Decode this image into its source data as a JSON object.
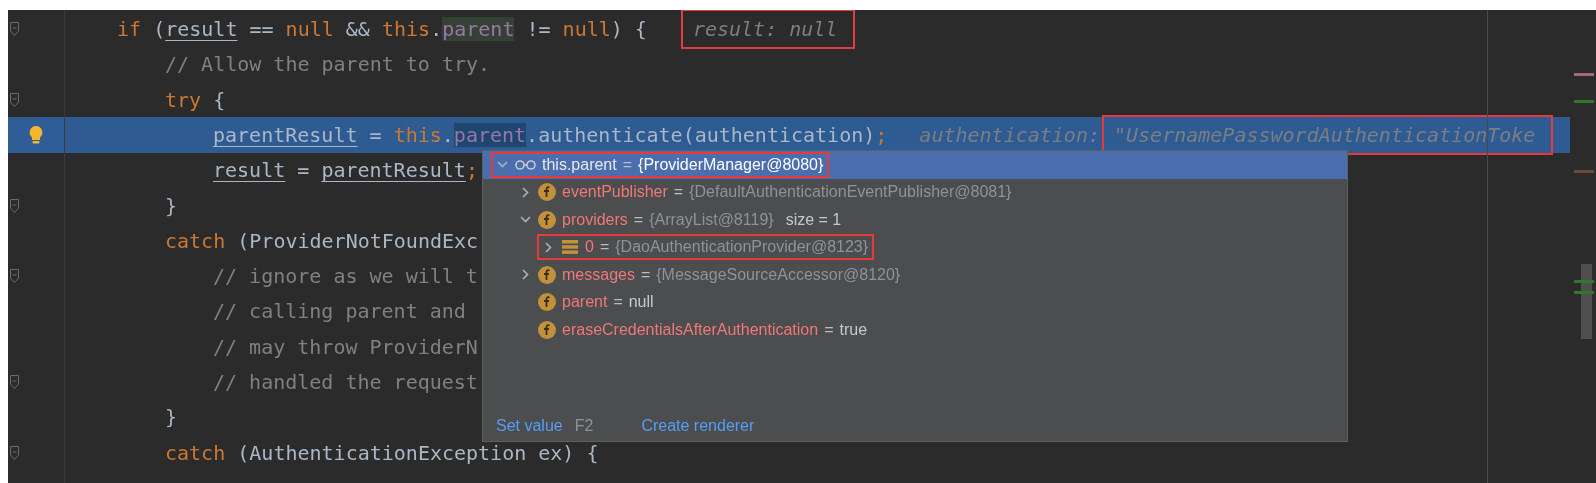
{
  "editor": {
    "lines": [
      {
        "current": false,
        "kind": "fold",
        "tokens": [
          {
            "kind": "keyword",
            "text": "if"
          },
          {
            "kind": "plain",
            "text": " ("
          },
          {
            "kind": "local",
            "text": "result"
          },
          {
            "kind": "plain",
            "text": " == "
          },
          {
            "kind": "keyword",
            "text": "null"
          },
          {
            "kind": "plain",
            "text": " && "
          },
          {
            "kind": "keyword",
            "text": "this"
          },
          {
            "kind": "plain",
            "text": "."
          },
          {
            "kind": "usage",
            "text": "parent"
          },
          {
            "kind": "plain",
            "text": " != "
          },
          {
            "kind": "keyword",
            "text": "null"
          },
          {
            "kind": "plain",
            "text": ") {"
          }
        ],
        "hints": [
          {
            "text": "result: null",
            "boxed": true
          }
        ],
        "children": [
          {
            "current": false,
            "kind": "plain",
            "tokens": [
              {
                "kind": "comment",
                "text": "// Allow the parent to try."
              }
            ]
          },
          {
            "current": false,
            "kind": "fold",
            "tokens": [
              {
                "kind": "keyword",
                "text": "try"
              },
              {
                "kind": "plain",
                "text": " {"
              }
            ],
            "children": [
              {
                "current": true,
                "kind": "bulb",
                "tokens": [
                  {
                    "kind": "local",
                    "text": "parentResult"
                  },
                  {
                    "kind": "plain",
                    "text": " = "
                  },
                  {
                    "kind": "keyword",
                    "text": "this"
                  },
                  {
                    "kind": "plain",
                    "text": "."
                  },
                  {
                    "kind": "usage",
                    "text": "parent"
                  },
                  {
                    "kind": "plain",
                    "text": ".authenticate(authentication)"
                  },
                  {
                    "kind": "keyword",
                    "text": ";"
                  }
                ],
                "hints": [
                  {
                    "text": "authentication:",
                    "boxed": false
                  },
                  {
                    "text": "\"UsernamePasswordAuthenticationToke",
                    "boxed": true
                  }
                ]
              },
              {
                "current": false,
                "kind": "plain",
                "tokens": [
                  {
                    "kind": "local",
                    "text": "result"
                  },
                  {
                    "kind": "plain",
                    "text": " = "
                  },
                  {
                    "kind": "local",
                    "text": "parentResult"
                  },
                  {
                    "kind": "keyword",
                    "text": ";"
                  }
                ]
              }
            ]
          },
          {
            "current": false,
            "kind": "fold",
            "tokens": [
              {
                "kind": "plain",
                "text": "}"
              }
            ]
          },
          {
            "current": false,
            "kind": "plain",
            "tokens": [
              {
                "kind": "keyword",
                "text": "catch"
              },
              {
                "kind": "plain",
                "text": " (ProviderNotFoundExc"
              }
            ],
            "children": [
              {
                "current": false,
                "kind": "fold",
                "tokens": [
                  {
                    "kind": "comment",
                    "text": "// ignore as we will t"
                  }
                ]
              },
              {
                "current": false,
                "kind": "plain",
                "tokens": [
                  {
                    "kind": "comment",
                    "text": "// calling parent and"
                  }
                ]
              },
              {
                "current": false,
                "kind": "plain",
                "tokens": [
                  {
                    "kind": "comment",
                    "text": "// may throw ProviderN"
                  }
                ]
              },
              {
                "current": false,
                "kind": "fold",
                "tokens": [
                  {
                    "kind": "comment",
                    "text": "// handled the request"
                  }
                ]
              }
            ]
          },
          {
            "current": false,
            "kind": "plain",
            "tokens": [
              {
                "kind": "plain",
                "text": "}"
              }
            ]
          },
          {
            "current": false,
            "kind": "fold",
            "tokens": [
              {
                "kind": "keyword",
                "text": "catch"
              },
              {
                "kind": "plain",
                "text": " (AuthenticationException ex) {"
              }
            ]
          }
        ]
      }
    ]
  },
  "value_popup": {
    "tree": [
      {
        "kind": "watch",
        "name": "this.parent",
        "operator": "=",
        "value": "{ProviderManager@8080}",
        "literal": false,
        "selected": true,
        "expanded": true,
        "boxed": true,
        "children": [
          {
            "kind": "field",
            "name": "eventPublisher",
            "operator": "=",
            "value": "{DefaultAuthenticationEventPublisher@8081}",
            "literal": false,
            "selected": false,
            "expanded": false,
            "boxed": false
          },
          {
            "kind": "field",
            "name": "providers",
            "operator": "=",
            "value": "{ArrayList@8119}",
            "literal": false,
            "extra": "size = 1",
            "selected": false,
            "expanded": true,
            "boxed": false,
            "children": [
              {
                "kind": "element",
                "name": "0",
                "operator": "=",
                "value": "{DaoAuthenticationProvider@8123}",
                "literal": false,
                "selected": false,
                "expanded": false,
                "boxed": true
              }
            ]
          },
          {
            "kind": "field",
            "name": "messages",
            "operator": "=",
            "value": "{MessageSourceAccessor@8120}",
            "literal": false,
            "selected": false,
            "expanded": false,
            "boxed": false
          },
          {
            "kind": "field",
            "name": "parent",
            "operator": "=",
            "value": "null",
            "literal": true,
            "selected": false,
            "boxed": false
          },
          {
            "kind": "field",
            "name": "eraseCredentialsAfterAuthentication",
            "operator": "=",
            "value": "true",
            "literal": true,
            "selected": false,
            "boxed": false
          }
        ]
      }
    ],
    "actions": [
      {
        "label": "Set value",
        "shortcut": "F2"
      },
      {
        "label": "Create renderer"
      }
    ]
  }
}
